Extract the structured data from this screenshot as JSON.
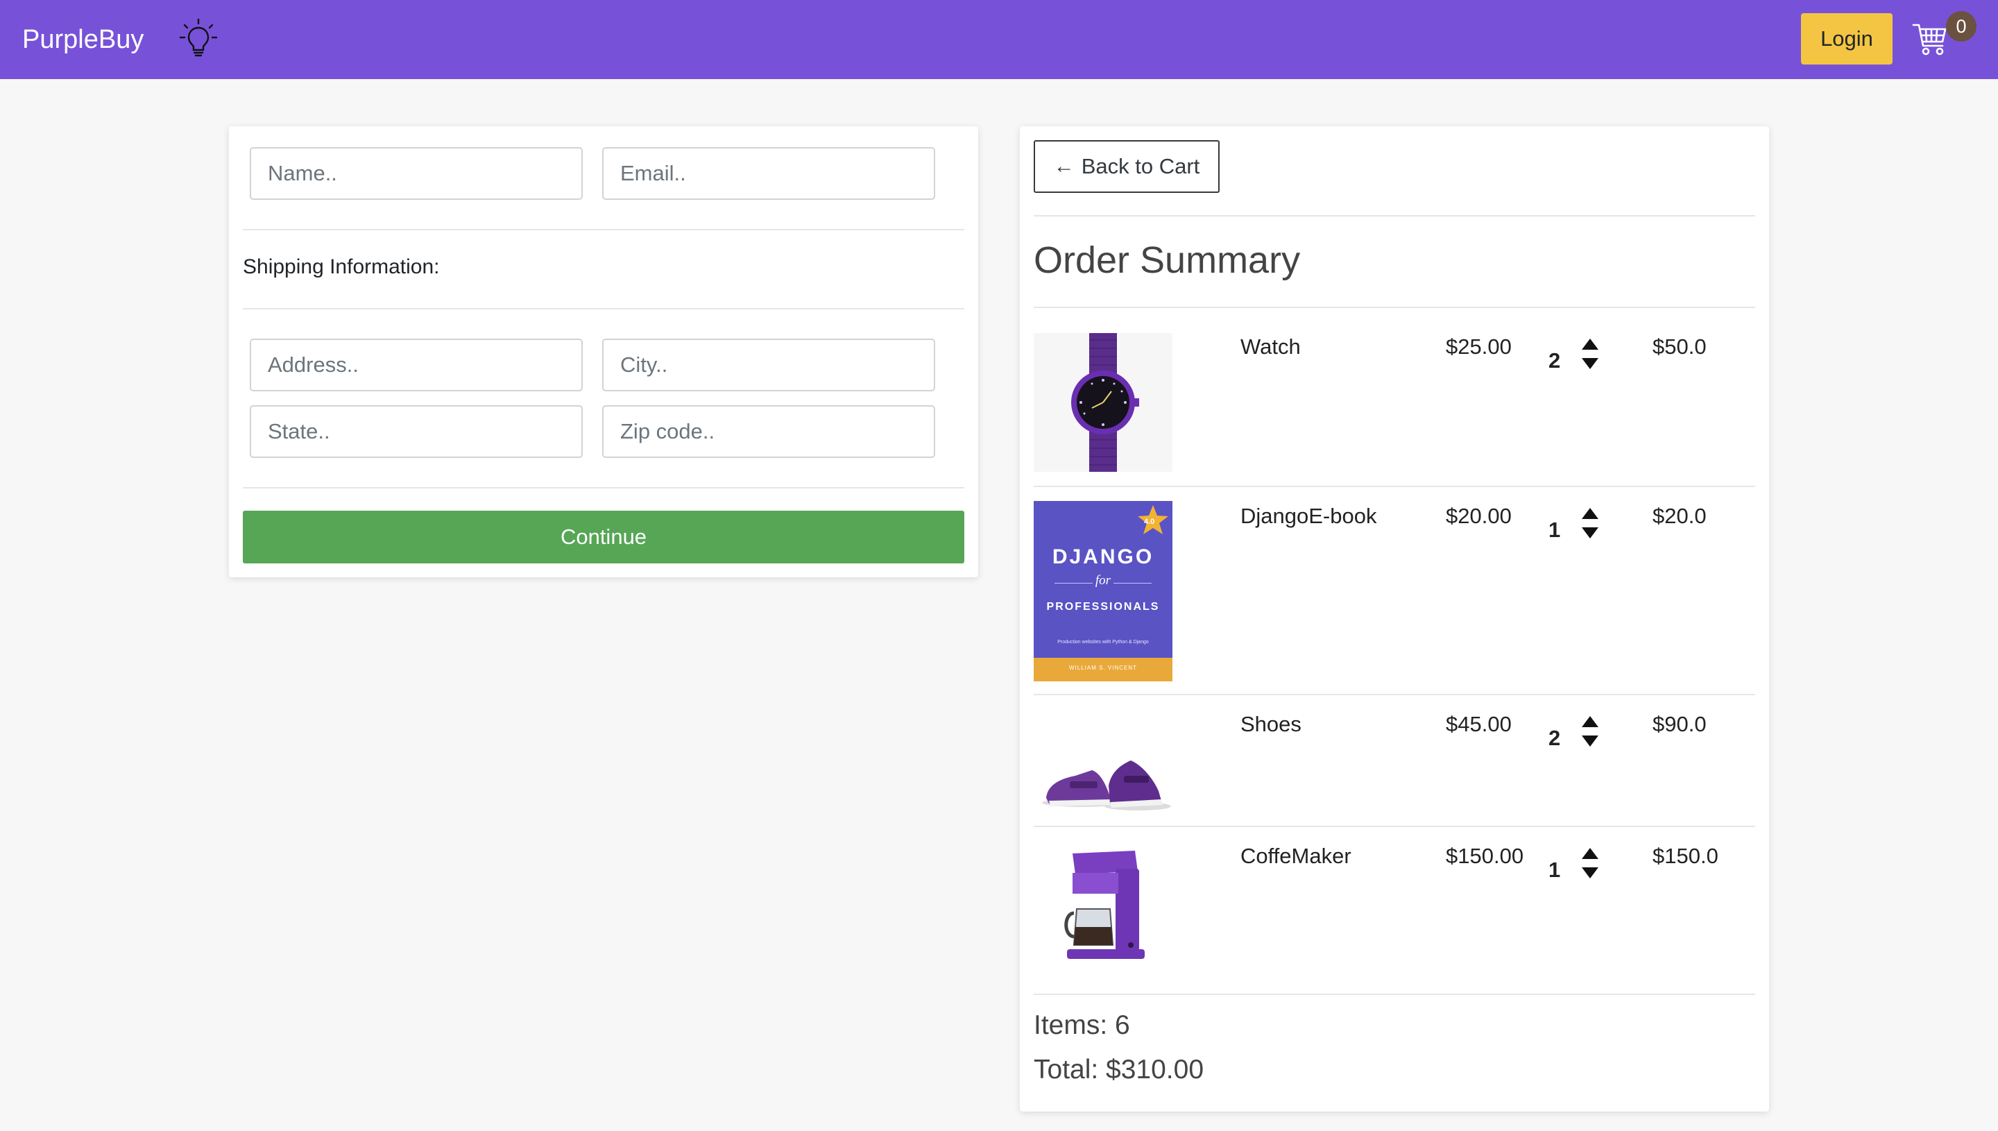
{
  "navbar": {
    "brand": "PurpleBuy",
    "bulb_icon": "lightbulb-icon",
    "login_label": "Login",
    "cart_icon": "shopping-cart-icon",
    "cart_count": "0"
  },
  "form": {
    "name_placeholder": "Name..",
    "email_placeholder": "Email..",
    "shipping_label": "Shipping Information:",
    "address_placeholder": "Address..",
    "city_placeholder": "City..",
    "state_placeholder": "State..",
    "zip_placeholder": "Zip code..",
    "continue_label": "Continue"
  },
  "summary": {
    "back_label": "Back to Cart",
    "back_icon": "arrow-left-icon",
    "title": "Order Summary",
    "items": [
      {
        "name": "Watch",
        "price": "$25.00",
        "quantity": "2",
        "total": "$50.0"
      },
      {
        "name": "DjangoE-book",
        "price": "$20.00",
        "quantity": "1",
        "total": "$20.0"
      },
      {
        "name": "Shoes",
        "price": "$45.00",
        "quantity": "2",
        "total": "$90.0"
      },
      {
        "name": "CoffeMaker",
        "price": "$150.00",
        "quantity": "1",
        "total": "$150.0"
      }
    ],
    "book_cover": {
      "title": "DJANGO",
      "for": "for",
      "subtitle": "PROFESSIONALS",
      "tagline": "Production websites with Python & Django",
      "author": "WILLIAM S. VINCENT",
      "badge": "4.0"
    },
    "items_count": "Items: 6",
    "total": "Total: $310.00"
  },
  "colors": {
    "navbar": "#7752d8",
    "login_button": "#f4c542",
    "continue_button": "#56a656"
  }
}
